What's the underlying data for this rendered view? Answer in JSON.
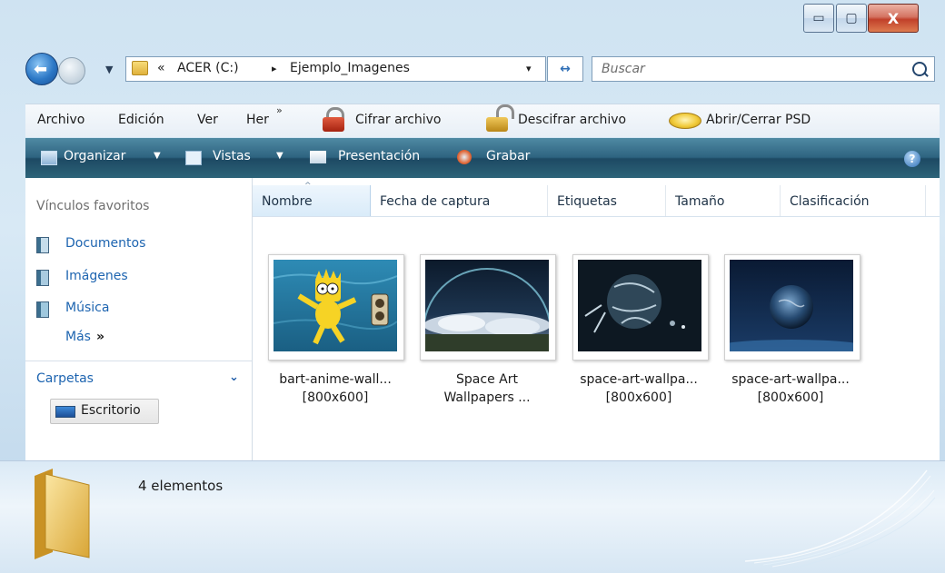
{
  "window": {
    "minimize_glyph": "▭",
    "maximize_glyph": "▢",
    "close_glyph": "X"
  },
  "address": {
    "overflow": "«",
    "root": "ACER (C:)",
    "separator": "▸",
    "folder": "Ejemplo_Imagenes",
    "dropdown": "▾",
    "refresh_glyph": "↔"
  },
  "search": {
    "placeholder": "Buscar"
  },
  "menu": {
    "archivo": "Archivo",
    "edicion": "Edición",
    "ver": "Ver",
    "her": "Her",
    "chevron": "»",
    "cifrar": "Cifrar archivo",
    "descifrar": "Descifrar archivo",
    "psd": "Abrir/Cerrar PSD"
  },
  "commandbar": {
    "organizar": "Organizar",
    "vistas": "Vistas",
    "presentacion": "Presentación",
    "grabar": "Grabar",
    "arrow": "▼",
    "help": "?"
  },
  "sidebar": {
    "favorites_title": "Vínculos favoritos",
    "favorites": [
      {
        "label": "Documentos",
        "icon": "documents-icon"
      },
      {
        "label": "Imágenes",
        "icon": "pictures-icon"
      },
      {
        "label": "Música",
        "icon": "music-icon"
      }
    ],
    "more": "Más",
    "more_glyph": "»",
    "folders_title": "Carpetas",
    "folders_toggle": "⌄",
    "folder_item": "Escritorio"
  },
  "columns": {
    "nombre": "Nombre",
    "fecha": "Fecha de captura",
    "etiquetas": "Etiquetas",
    "tamano": "Tamaño",
    "clasificacion": "Clasificación",
    "sort_glyph": "^"
  },
  "files": [
    {
      "line1": "bart-anime-wall...",
      "line2": "[800x600]"
    },
    {
      "line1": "Space Art",
      "line2": "Wallpapers ..."
    },
    {
      "line1": "space-art-wallpa...",
      "line2": "[800x600]"
    },
    {
      "line1": "space-art-wallpa...",
      "line2": "[800x600]"
    }
  ],
  "details": {
    "count": "4 elementos"
  },
  "colors": {
    "link_blue": "#1d64b0",
    "command_bar": "#2e6380"
  }
}
